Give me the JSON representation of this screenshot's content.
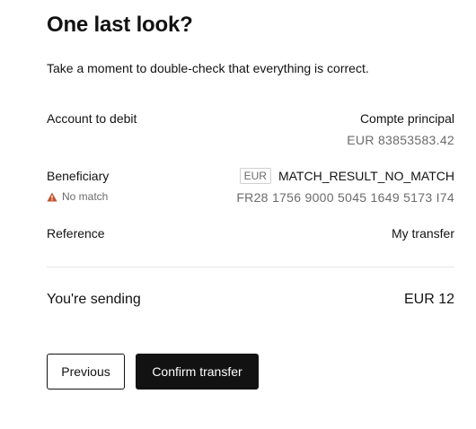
{
  "header": {
    "title": "One last look?",
    "subtitle": "Take a moment to double-check that everything is correct."
  },
  "account_to_debit": {
    "label": "Account to debit",
    "name": "Compte principal",
    "balance": "EUR 83853583.42"
  },
  "beneficiary": {
    "label": "Beneficiary",
    "match_status": "No match",
    "currency": "EUR",
    "name": "MATCH_RESULT_NO_MATCH",
    "iban": "FR28 1756 9000 5045 1649 5173 I74"
  },
  "reference": {
    "label": "Reference",
    "value": "My transfer"
  },
  "summary": {
    "label": "You're sending",
    "amount": "EUR 12"
  },
  "actions": {
    "previous_label": "Previous",
    "confirm_label": "Confirm transfer"
  },
  "colors": {
    "primary": "#121212",
    "muted_text": "#6b6b6b",
    "warning": "#c0532b",
    "divider": "#e6e6e6"
  },
  "icons": {
    "match_status_icon": "warning-triangle-icon"
  }
}
